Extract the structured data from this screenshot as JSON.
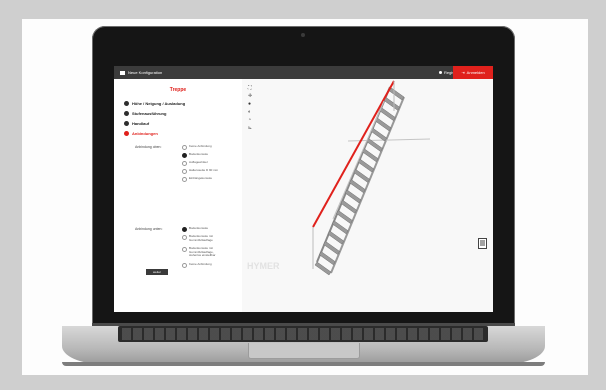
{
  "window": {
    "title": "Neue Konfiguration",
    "register": "Registrieren",
    "login": "Anmelden"
  },
  "config": {
    "heading": "Treppe",
    "steps": [
      {
        "label": "Höhe / Neigung / Ausladung"
      },
      {
        "label": "Stufenausführung"
      },
      {
        "label": "Handlauf"
      },
      {
        "label": "Anbindungen"
      }
    ],
    "top_label": "Anbindung oben:",
    "top_options": [
      "Keine Anbindung",
      "Bodenkonsole",
      "Auflagewinkel",
      "Halterosette D 90 mm",
      "Einhängekonsole"
    ],
    "bottom_label": "Anbindung unten:",
    "bottom_options": [
      "Bodenkonsole",
      "Bodenkonsole mit Gummifußauflage",
      "Bodenkonsole mit Gummifußauflage, stufenlos einstellbar",
      "Keine Anbindung"
    ],
    "next_button": "weiter"
  },
  "viewer": {
    "watermark": "HYMER"
  },
  "colors": {
    "accent": "#e0211c",
    "topbar": "#3b3b3b"
  },
  "icons": [
    "fullscreen-icon",
    "pan-icon",
    "zoom-icon",
    "rotate-icon",
    "reset-icon",
    "measure-icon",
    "document-icon"
  ]
}
